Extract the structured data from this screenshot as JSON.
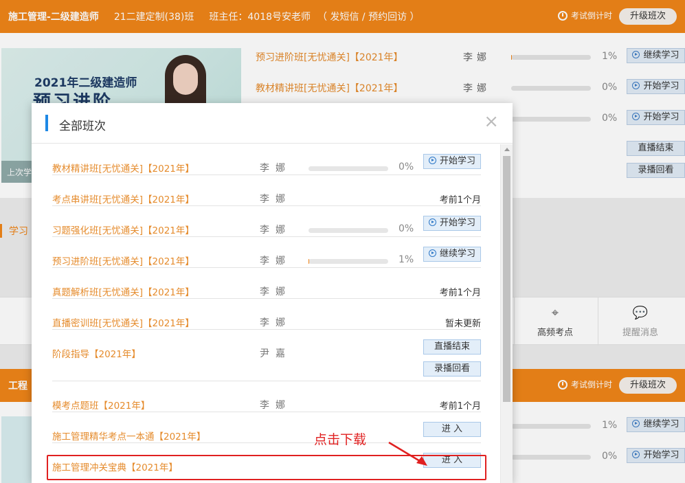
{
  "header": {
    "title": "施工管理-二级建造师",
    "class_name": "21二建定制(38)班",
    "teacher": "班主任：4018号安老师",
    "contact": "（ 发短信 / 预约回访 ）",
    "countdown": "考试倒计时",
    "upgrade": "升级班次"
  },
  "banner": {
    "year_text": "2021年二级建造师",
    "big_text": "预习进阶",
    "last_text": "上次学"
  },
  "bg_courses": [
    {
      "name": "预习进阶班[无忧通关]【2021年】",
      "teacher": "李娜",
      "progress": 0.01,
      "pct": "1%",
      "button": "继续学习"
    },
    {
      "name": "教材精讲班[无忧通关]【2021年】",
      "teacher": "李娜",
      "progress": 0,
      "pct": "0%",
      "button": "开始学习"
    },
    {
      "pct": "0%",
      "button": "开始学习"
    }
  ],
  "bg_extra_buttons": [
    "直播结束",
    "录播回看"
  ],
  "study_label": "学习",
  "tools": [
    {
      "icon": "target-icon",
      "label": "高频考点"
    },
    {
      "icon": "chat-icon",
      "label": "提醒消息"
    }
  ],
  "header2": {
    "title": "工程",
    "countdown": "考试倒计时",
    "upgrade": "升级班次"
  },
  "bg_courses2": [
    {
      "pct": "1%",
      "button": "继续学习"
    },
    {
      "pct": "0%",
      "button": "开始学习"
    }
  ],
  "modal": {
    "title": "全部班次",
    "close": "×",
    "rows": [
      {
        "name": "教材精讲班[无忧通关]【2021年】",
        "teacher": "李娜",
        "type": "progress",
        "progress": 0,
        "pct": "0%",
        "button": "开始学习"
      },
      {
        "name": "考点串讲班[无忧通关]【2021年】",
        "teacher": "李娜",
        "type": "status",
        "status": "考前1个月"
      },
      {
        "name": "习题强化班[无忧通关]【2021年】",
        "teacher": "李娜",
        "type": "progress",
        "progress": 0,
        "pct": "0%",
        "button": "开始学习"
      },
      {
        "name": "预习进阶班[无忧通关]【2021年】",
        "teacher": "李娜",
        "type": "progress",
        "progress": 0.01,
        "pct": "1%",
        "button": "继续学习"
      },
      {
        "name": "真题解析班[无忧通关]【2021年】",
        "teacher": "李娜",
        "type": "status",
        "status": "考前1个月"
      },
      {
        "name": "直播密训班[无忧通关]【2021年】",
        "teacher": "李娜",
        "type": "status",
        "status": "暂未更新"
      },
      {
        "name": "阶段指导【2021年】",
        "teacher": "尹嘉",
        "type": "double",
        "buttons": [
          "直播结束",
          "录播回看"
        ]
      },
      {
        "name": "模考点题班【2021年】",
        "teacher": "李娜",
        "type": "status",
        "status": "考前1个月"
      },
      {
        "name": "施工管理精华考点一本通【2021年】",
        "teacher": "",
        "type": "enter",
        "button": "进 入"
      },
      {
        "name": "施工管理冲关宝典【2021年】",
        "teacher": "",
        "type": "enter",
        "button": "进 入"
      }
    ]
  },
  "annotation": {
    "hint": "点击下载",
    "color": "#e02020"
  },
  "colors": {
    "brand_orange": "#f08519",
    "course_name": "#e58b2c",
    "accent_blue": "#1e88e5"
  }
}
